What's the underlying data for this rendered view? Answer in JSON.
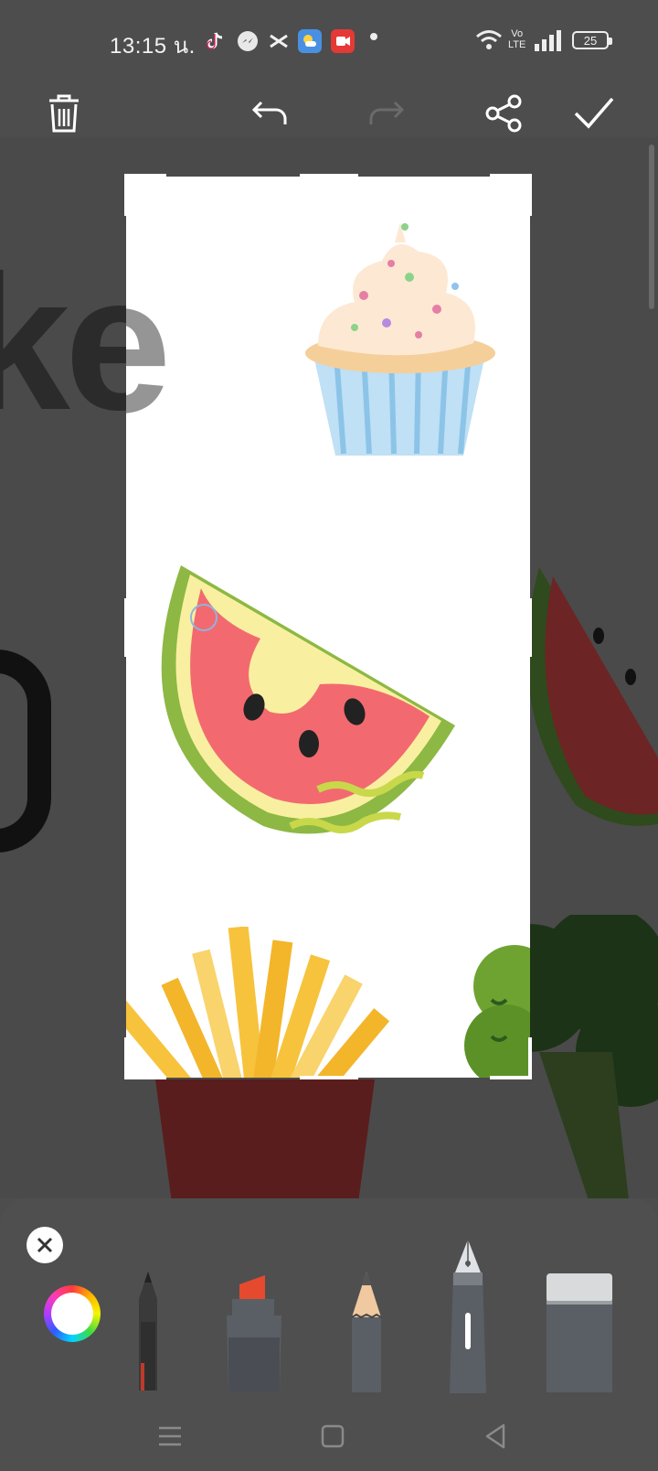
{
  "status_bar": {
    "time": "13:15 น.",
    "network_label_top": "Vo",
    "network_label_bottom": "LTE",
    "battery": "25"
  },
  "toolbar": {
    "delete_icon": "trash-icon",
    "undo_icon": "undo-icon",
    "redo_icon": "redo-icon",
    "share_icon": "share-icon",
    "done_icon": "check-icon"
  },
  "canvas": {
    "background_text": "ke"
  },
  "pen_panel": {
    "selected_color": "#ffffff",
    "tools": [
      "ballpoint-pen",
      "marker",
      "pencil",
      "fountain-pen",
      "eraser"
    ]
  },
  "nav_bar": {
    "icons": [
      "recent-apps-icon",
      "home-icon",
      "back-icon"
    ]
  }
}
